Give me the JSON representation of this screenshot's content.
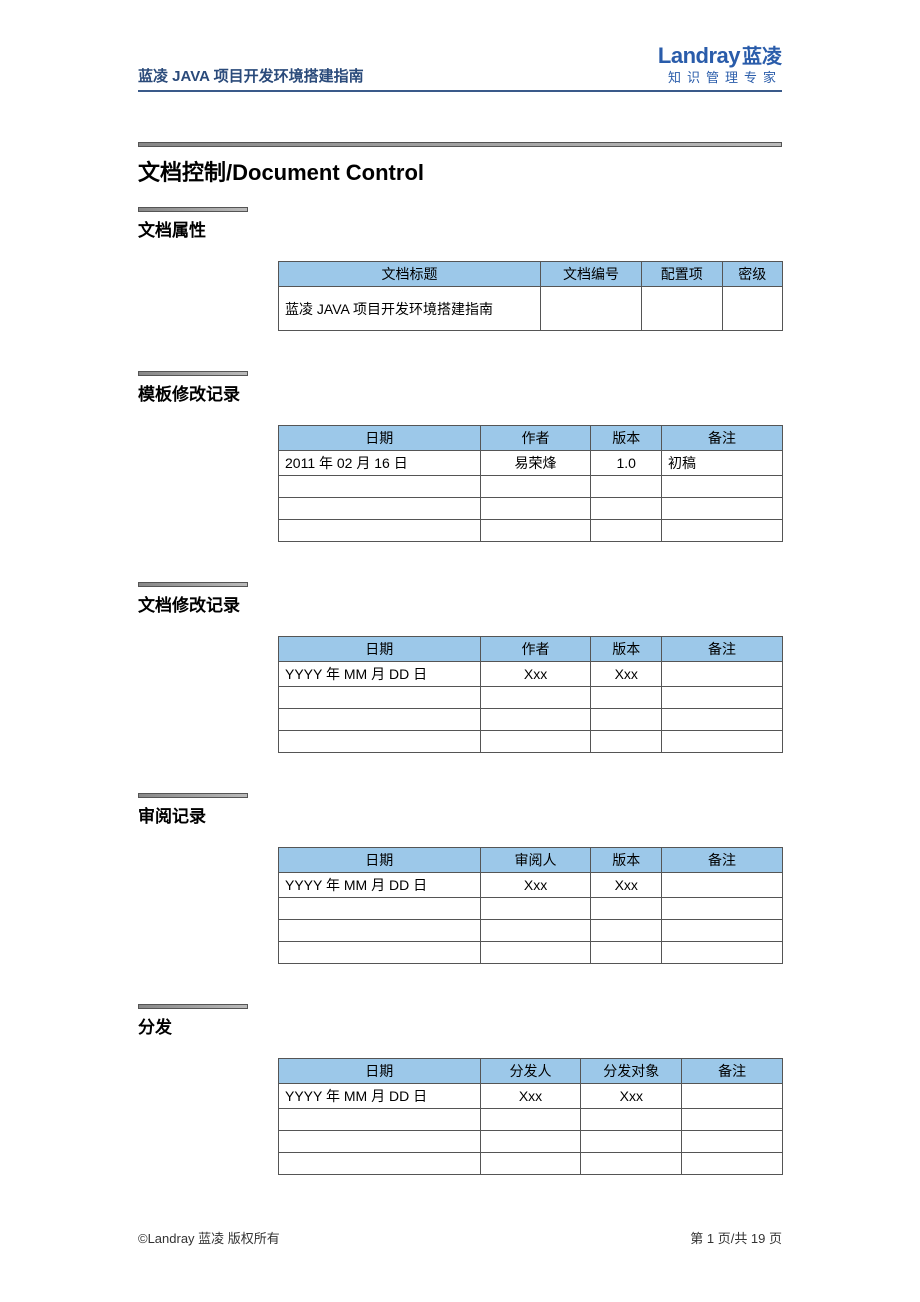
{
  "header": {
    "title": "蓝凌 JAVA 项目开发环境搭建指南",
    "logo_en": "Landray",
    "logo_cn": "蓝凌",
    "logo_sub": "知识管理专家"
  },
  "main_title": "文档控制/Document Control",
  "sections": {
    "attributes": {
      "title": "文档属性",
      "headers": [
        "文档标题",
        "文档编号",
        "配置项",
        "密级"
      ],
      "row": {
        "doc_title": "蓝凌 JAVA 项目开发环境搭建指南",
        "doc_no": "",
        "config": "",
        "secret": ""
      }
    },
    "template_rev": {
      "title": "模板修改记录",
      "headers": [
        "日期",
        "作者",
        "版本",
        "备注"
      ],
      "rows": [
        {
          "date": "2011 年 02 月 16 日",
          "author": "易荣烽",
          "version": "1.0",
          "note": "初稿"
        },
        {
          "date": "",
          "author": "",
          "version": "",
          "note": ""
        },
        {
          "date": "",
          "author": "",
          "version": "",
          "note": ""
        },
        {
          "date": "",
          "author": "",
          "version": "",
          "note": ""
        }
      ]
    },
    "doc_rev": {
      "title": "文档修改记录",
      "headers": [
        "日期",
        "作者",
        "版本",
        "备注"
      ],
      "rows": [
        {
          "date": "YYYY 年 MM 月 DD 日",
          "author": "Xxx",
          "version": "Xxx",
          "note": ""
        },
        {
          "date": "",
          "author": "",
          "version": "",
          "note": ""
        },
        {
          "date": "",
          "author": "",
          "version": "",
          "note": ""
        },
        {
          "date": "",
          "author": "",
          "version": "",
          "note": ""
        }
      ]
    },
    "review": {
      "title": "审阅记录",
      "headers": [
        "日期",
        "审阅人",
        "版本",
        "备注"
      ],
      "rows": [
        {
          "date": "YYYY 年 MM 月 DD 日",
          "author": "Xxx",
          "version": "Xxx",
          "note": ""
        },
        {
          "date": "",
          "author": "",
          "version": "",
          "note": ""
        },
        {
          "date": "",
          "author": "",
          "version": "",
          "note": ""
        },
        {
          "date": "",
          "author": "",
          "version": "",
          "note": ""
        }
      ]
    },
    "dist": {
      "title": "分发",
      "headers": [
        "日期",
        "分发人",
        "分发对象",
        "备注"
      ],
      "rows": [
        {
          "date": "YYYY 年 MM 月 DD 日",
          "author": "Xxx",
          "version": "Xxx",
          "note": ""
        },
        {
          "date": "",
          "author": "",
          "version": "",
          "note": ""
        },
        {
          "date": "",
          "author": "",
          "version": "",
          "note": ""
        },
        {
          "date": "",
          "author": "",
          "version": "",
          "note": ""
        }
      ]
    }
  },
  "footer": {
    "copyright": "©Landray 蓝凌  版权所有",
    "page": "第  1  页/共  19 页"
  }
}
